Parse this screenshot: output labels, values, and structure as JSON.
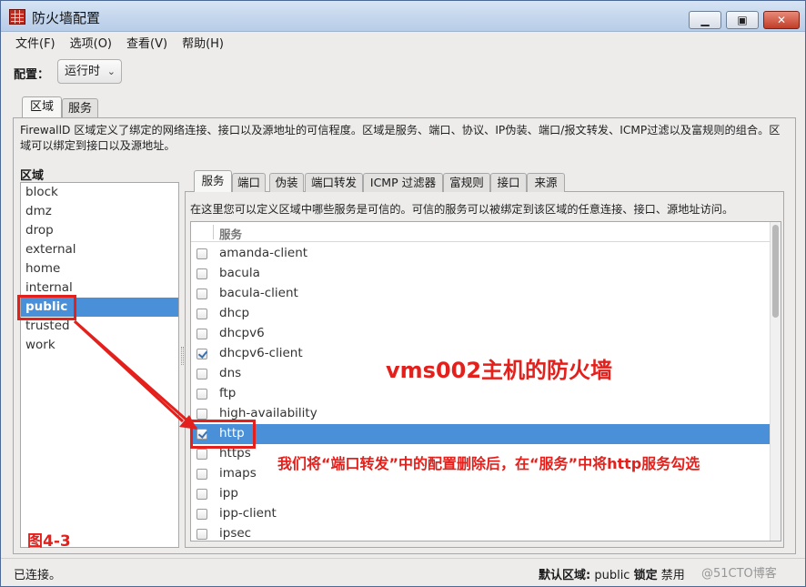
{
  "window": {
    "title": "防火墙配置"
  },
  "menu": [
    "文件(F)",
    "选项(O)",
    "查看(V)",
    "帮助(H)"
  ],
  "config": {
    "label": "配置：",
    "value": "运行时"
  },
  "tabs": [
    "区域",
    "服务"
  ],
  "zone_description": "FirewallD 区域定义了绑定的网络连接、接口以及源地址的可信程度。区域是服务、端口、协议、IP伪装、端口/报文转发、ICMP过滤以及富规则的组合。区域可以绑定到接口以及源地址。",
  "zones_heading": "区域",
  "zones": [
    "block",
    "dmz",
    "drop",
    "external",
    "home",
    "internal",
    "public",
    "trusted",
    "work"
  ],
  "selected_zone_index": 6,
  "inner_tabs": [
    "服务",
    "端口",
    "伪装",
    "端口转发",
    "ICMP 过滤器",
    "富规则",
    "接口",
    "来源"
  ],
  "service_description": "在这里您可以定义区域中哪些服务是可信的。可信的服务可以被绑定到该区域的任意连接、接口、源地址访问。",
  "services_column": "服务",
  "services": [
    {
      "name": "amanda-client",
      "checked": false
    },
    {
      "name": "bacula",
      "checked": false
    },
    {
      "name": "bacula-client",
      "checked": false
    },
    {
      "name": "dhcp",
      "checked": false
    },
    {
      "name": "dhcpv6",
      "checked": false
    },
    {
      "name": "dhcpv6-client",
      "checked": true
    },
    {
      "name": "dns",
      "checked": false
    },
    {
      "name": "ftp",
      "checked": false
    },
    {
      "name": "high-availability",
      "checked": false
    },
    {
      "name": "http",
      "checked": true,
      "selected": true
    },
    {
      "name": "https",
      "checked": false
    },
    {
      "name": "imaps",
      "checked": false
    },
    {
      "name": "ipp",
      "checked": false
    },
    {
      "name": "ipp-client",
      "checked": false
    },
    {
      "name": "ipsec",
      "checked": false
    }
  ],
  "status": {
    "connection": "已连接。",
    "default_zone_label": "默认区域:",
    "default_zone": "public",
    "lock_label": "锁定",
    "lock_value": "禁用"
  },
  "annotations": {
    "title": "vms002主机的防火墙",
    "note": "我们将“端口转发”中的配置删除后，在“服务”中将http服务勾选",
    "figure": "图4-3",
    "watermark": "@51CTO博客"
  },
  "colors": {
    "annotation": "#e3201b",
    "selection": "#4a90d9"
  }
}
